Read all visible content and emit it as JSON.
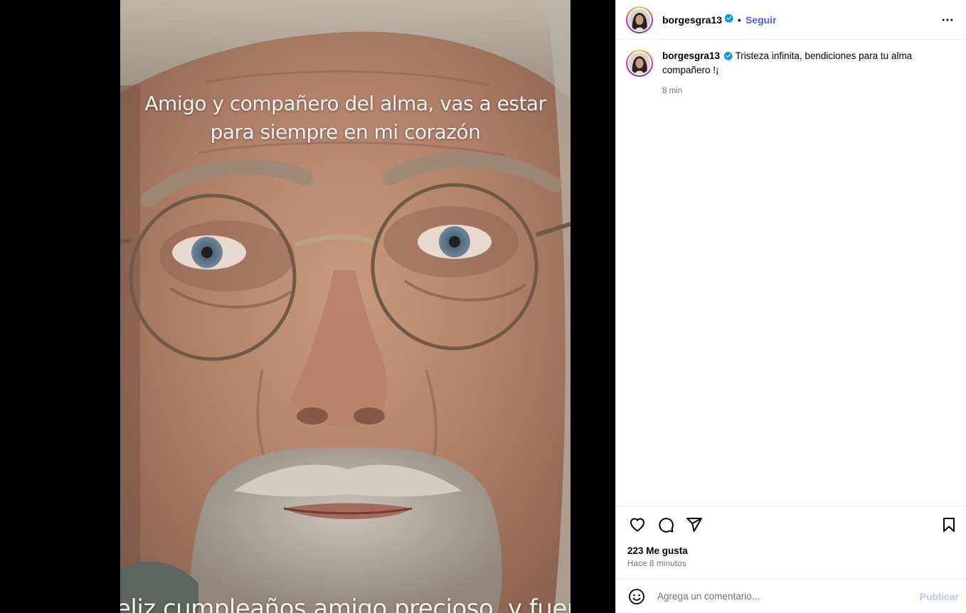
{
  "media": {
    "overlay_line1": "Amigo y compañero del alma, vas a estar",
    "overlay_line2": "para siempre en mi corazón",
    "overlay_bottom": "eliz cumpleaños amigo precioso, y fuerza!!"
  },
  "header": {
    "username": "borgesgra13",
    "separator": "•",
    "follow_label": "Seguir"
  },
  "caption": {
    "username": "borgesgra13",
    "text": "Tristeza infinita, bendiciones para tu alma compañero !¡",
    "time": "8 min"
  },
  "actions": {
    "likes": "223 Me gusta",
    "post_time": "Hace 8 minutos"
  },
  "comment_bar": {
    "placeholder": "Agrega un comentario...",
    "publish_label": "Publicar"
  },
  "colors": {
    "follow": "#4a5df9",
    "verified": "#0095f6",
    "publish_disabled": "#b3c6f7",
    "secondary_text": "#737373"
  },
  "icons": [
    "verified-badge-icon",
    "more-options-icon",
    "heart-icon",
    "comment-icon",
    "share-icon",
    "bookmark-icon",
    "emoji-icon"
  ]
}
